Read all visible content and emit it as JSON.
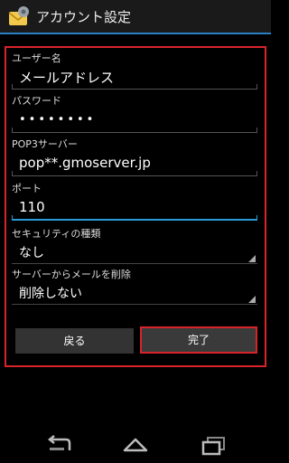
{
  "actionbar": {
    "title": "アカウント設定"
  },
  "form": {
    "username_label": "ユーザー名",
    "username_value": "メールアドレス",
    "password_label": "パスワード",
    "password_value": "••••••••",
    "pop3_label": "POP3サーバー",
    "pop3_value": "pop**.gmoserver.jp",
    "port_label": "ポート",
    "port_value": "110",
    "security_label": "セキュリティの種類",
    "security_value": "なし",
    "delete_label": "サーバーからメールを削除",
    "delete_value": "削除しない"
  },
  "buttons": {
    "back_label": "戻る",
    "done_label": "完了"
  },
  "colors": {
    "accent": "#2a9ad8",
    "highlight": "#d8232a"
  },
  "icons": {
    "app": "email-settings-icon",
    "back": "back-arrow-icon",
    "home": "home-icon",
    "recents": "recent-apps-icon"
  }
}
